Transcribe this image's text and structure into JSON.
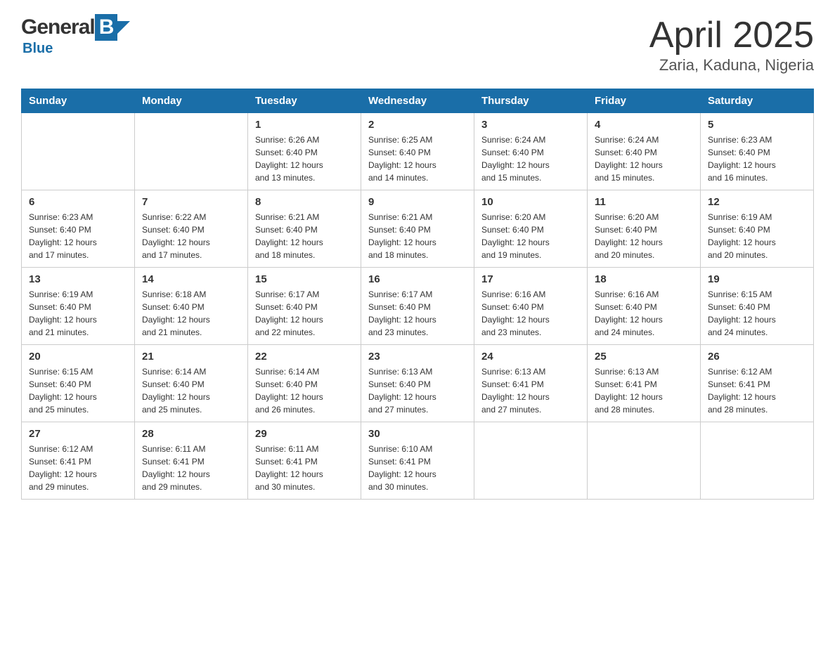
{
  "header": {
    "logo": {
      "general": "General",
      "blue": "Blue"
    },
    "title": "April 2025",
    "location": "Zaria, Kaduna, Nigeria"
  },
  "calendar": {
    "days_of_week": [
      "Sunday",
      "Monday",
      "Tuesday",
      "Wednesday",
      "Thursday",
      "Friday",
      "Saturday"
    ],
    "weeks": [
      [
        {
          "day": "",
          "info": ""
        },
        {
          "day": "",
          "info": ""
        },
        {
          "day": "1",
          "info": "Sunrise: 6:26 AM\nSunset: 6:40 PM\nDaylight: 12 hours\nand 13 minutes."
        },
        {
          "day": "2",
          "info": "Sunrise: 6:25 AM\nSunset: 6:40 PM\nDaylight: 12 hours\nand 14 minutes."
        },
        {
          "day": "3",
          "info": "Sunrise: 6:24 AM\nSunset: 6:40 PM\nDaylight: 12 hours\nand 15 minutes."
        },
        {
          "day": "4",
          "info": "Sunrise: 6:24 AM\nSunset: 6:40 PM\nDaylight: 12 hours\nand 15 minutes."
        },
        {
          "day": "5",
          "info": "Sunrise: 6:23 AM\nSunset: 6:40 PM\nDaylight: 12 hours\nand 16 minutes."
        }
      ],
      [
        {
          "day": "6",
          "info": "Sunrise: 6:23 AM\nSunset: 6:40 PM\nDaylight: 12 hours\nand 17 minutes."
        },
        {
          "day": "7",
          "info": "Sunrise: 6:22 AM\nSunset: 6:40 PM\nDaylight: 12 hours\nand 17 minutes."
        },
        {
          "day": "8",
          "info": "Sunrise: 6:21 AM\nSunset: 6:40 PM\nDaylight: 12 hours\nand 18 minutes."
        },
        {
          "day": "9",
          "info": "Sunrise: 6:21 AM\nSunset: 6:40 PM\nDaylight: 12 hours\nand 18 minutes."
        },
        {
          "day": "10",
          "info": "Sunrise: 6:20 AM\nSunset: 6:40 PM\nDaylight: 12 hours\nand 19 minutes."
        },
        {
          "day": "11",
          "info": "Sunrise: 6:20 AM\nSunset: 6:40 PM\nDaylight: 12 hours\nand 20 minutes."
        },
        {
          "day": "12",
          "info": "Sunrise: 6:19 AM\nSunset: 6:40 PM\nDaylight: 12 hours\nand 20 minutes."
        }
      ],
      [
        {
          "day": "13",
          "info": "Sunrise: 6:19 AM\nSunset: 6:40 PM\nDaylight: 12 hours\nand 21 minutes."
        },
        {
          "day": "14",
          "info": "Sunrise: 6:18 AM\nSunset: 6:40 PM\nDaylight: 12 hours\nand 21 minutes."
        },
        {
          "day": "15",
          "info": "Sunrise: 6:17 AM\nSunset: 6:40 PM\nDaylight: 12 hours\nand 22 minutes."
        },
        {
          "day": "16",
          "info": "Sunrise: 6:17 AM\nSunset: 6:40 PM\nDaylight: 12 hours\nand 23 minutes."
        },
        {
          "day": "17",
          "info": "Sunrise: 6:16 AM\nSunset: 6:40 PM\nDaylight: 12 hours\nand 23 minutes."
        },
        {
          "day": "18",
          "info": "Sunrise: 6:16 AM\nSunset: 6:40 PM\nDaylight: 12 hours\nand 24 minutes."
        },
        {
          "day": "19",
          "info": "Sunrise: 6:15 AM\nSunset: 6:40 PM\nDaylight: 12 hours\nand 24 minutes."
        }
      ],
      [
        {
          "day": "20",
          "info": "Sunrise: 6:15 AM\nSunset: 6:40 PM\nDaylight: 12 hours\nand 25 minutes."
        },
        {
          "day": "21",
          "info": "Sunrise: 6:14 AM\nSunset: 6:40 PM\nDaylight: 12 hours\nand 25 minutes."
        },
        {
          "day": "22",
          "info": "Sunrise: 6:14 AM\nSunset: 6:40 PM\nDaylight: 12 hours\nand 26 minutes."
        },
        {
          "day": "23",
          "info": "Sunrise: 6:13 AM\nSunset: 6:40 PM\nDaylight: 12 hours\nand 27 minutes."
        },
        {
          "day": "24",
          "info": "Sunrise: 6:13 AM\nSunset: 6:41 PM\nDaylight: 12 hours\nand 27 minutes."
        },
        {
          "day": "25",
          "info": "Sunrise: 6:13 AM\nSunset: 6:41 PM\nDaylight: 12 hours\nand 28 minutes."
        },
        {
          "day": "26",
          "info": "Sunrise: 6:12 AM\nSunset: 6:41 PM\nDaylight: 12 hours\nand 28 minutes."
        }
      ],
      [
        {
          "day": "27",
          "info": "Sunrise: 6:12 AM\nSunset: 6:41 PM\nDaylight: 12 hours\nand 29 minutes."
        },
        {
          "day": "28",
          "info": "Sunrise: 6:11 AM\nSunset: 6:41 PM\nDaylight: 12 hours\nand 29 minutes."
        },
        {
          "day": "29",
          "info": "Sunrise: 6:11 AM\nSunset: 6:41 PM\nDaylight: 12 hours\nand 30 minutes."
        },
        {
          "day": "30",
          "info": "Sunrise: 6:10 AM\nSunset: 6:41 PM\nDaylight: 12 hours\nand 30 minutes."
        },
        {
          "day": "",
          "info": ""
        },
        {
          "day": "",
          "info": ""
        },
        {
          "day": "",
          "info": ""
        }
      ]
    ]
  }
}
